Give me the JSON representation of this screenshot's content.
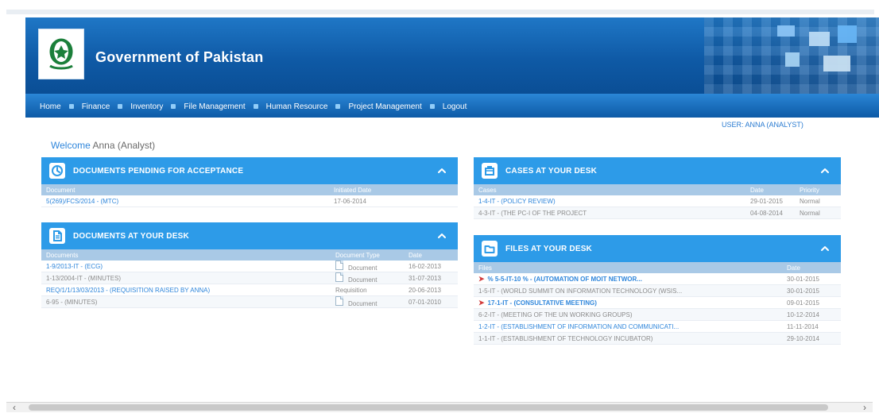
{
  "header": {
    "title": "Government of Pakistan"
  },
  "nav": {
    "items": [
      "Home",
      "Finance",
      "Inventory",
      "File Management",
      "Human Resource",
      "Project Management",
      "Logout"
    ]
  },
  "top": {
    "user_link": "USER: ANNA (ANALYST)"
  },
  "welcome": {
    "label": "Welcome",
    "name": "Anna (Analyst)"
  },
  "panels": {
    "pending": {
      "title": "DOCUMENTS PENDING FOR ACCEPTANCE",
      "columns": [
        "Document",
        "Initiated Date"
      ],
      "rows": [
        [
          "5(269)/FCS/2014 - (MTC)",
          "17-06-2014"
        ]
      ]
    },
    "cases": {
      "title": "CASES AT YOUR DESK",
      "columns": [
        "Cases",
        "Date",
        "Priority"
      ],
      "rows": [
        [
          "1-4-IT - (POLICY REVIEW)",
          "29-01-2015",
          "Normal"
        ],
        [
          "4-3-IT - (THE PC-I OF THE PROJECT",
          "04-08-2014",
          "Normal"
        ]
      ]
    },
    "docs": {
      "title": "DOCUMENTS AT YOUR DESK",
      "columns": [
        "Documents",
        "Document Type",
        "Date"
      ],
      "rows": [
        [
          "1-9/2013-IT - (ECG)",
          "Document",
          "16-02-2013"
        ],
        [
          "1-13/2004-IT - (MINUTES)",
          "Document",
          "31-07-2013"
        ],
        [
          "REQ/1/1/13/03/2013 - (REQUISITION RAISED BY ANNA)",
          "Requisition",
          "20-06-2013"
        ],
        [
          "6-95 - (MINUTES)",
          "Document",
          "07-01-2010"
        ]
      ]
    },
    "files": {
      "title": "FILES AT YOUR DESK",
      "columns": [
        "Files",
        "Date"
      ],
      "rows": [
        [
          "% 5-5-IT-10 % - (AUTOMATION OF MOIT NETWOR...",
          "30-01-2015"
        ],
        [
          "1-5-IT - (WORLD SUMMIT ON INFORMATION TECHNOLOGY (WSIS...",
          "30-01-2015"
        ],
        [
          "17-1-IT - (CONSULTATIVE MEETING)",
          "09-01-2015"
        ],
        [
          "6-2-IT - (MEETING OF THE UN WORKING GROUPS)",
          "10-12-2014"
        ],
        [
          "1-2-IT - (ESTABLISHMENT OF INFORMATION AND COMMUNICATI...",
          "11-11-2014"
        ],
        [
          "1-1-IT - (ESTABLISHMENT OF TECHNOLOGY INCUBATOR)",
          "29-10-2014"
        ]
      ]
    }
  },
  "colors": {
    "banner": "#0f5aa6",
    "panel": "#2d9be8",
    "link": "#2f86db",
    "flag": "#d23a3a"
  }
}
